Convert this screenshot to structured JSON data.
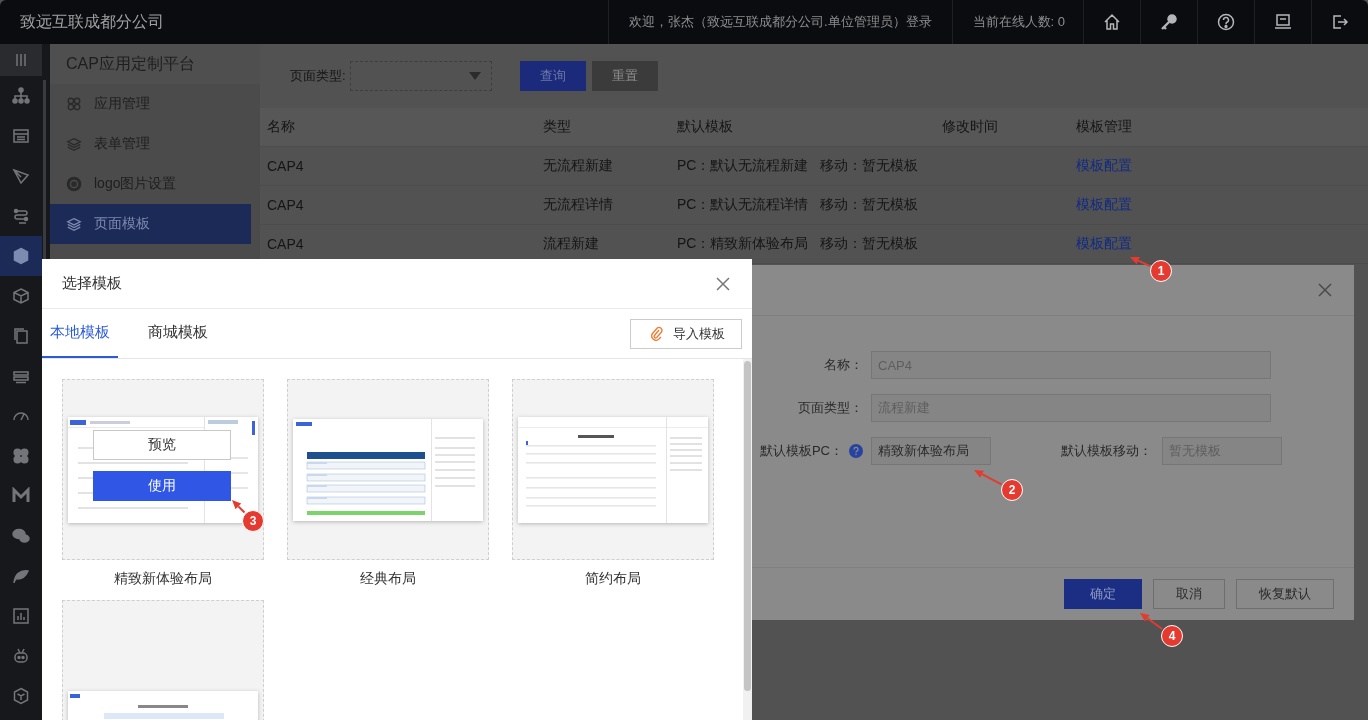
{
  "header": {
    "title": "致远互联成都分公司",
    "welcome": "欢迎，张杰（致远互联成都分公司.单位管理员）登录",
    "online": "当前在线人数: 0",
    "icons": [
      {
        "kind": "home"
      },
      {
        "kind": "key"
      },
      {
        "kind": "help"
      },
      {
        "kind": "monitor"
      },
      {
        "kind": "logout"
      }
    ]
  },
  "rail": [
    {
      "kind": "menu",
      "selected": false
    },
    {
      "kind": "tree",
      "selected": false
    },
    {
      "kind": "form",
      "selected": false
    },
    {
      "kind": "pen",
      "selected": false
    },
    {
      "kind": "flow",
      "selected": false
    },
    {
      "kind": "hexagon",
      "selected": true
    },
    {
      "kind": "cube",
      "selected": false
    },
    {
      "kind": "copy",
      "selected": false
    },
    {
      "kind": "stack",
      "selected": false
    },
    {
      "kind": "gauge",
      "selected": false
    },
    {
      "kind": "clover",
      "selected": false
    },
    {
      "kind": "zigzag",
      "selected": false
    },
    {
      "kind": "chat",
      "selected": false
    },
    {
      "kind": "leaf",
      "selected": false
    },
    {
      "kind": "chart",
      "selected": false
    },
    {
      "kind": "robot",
      "selected": false
    },
    {
      "kind": "cubes",
      "selected": false
    }
  ],
  "sidebar": {
    "title": "CAP应用定制平台",
    "items": [
      {
        "kind": "apps",
        "label": "应用管理",
        "selected": false
      },
      {
        "kind": "layers",
        "label": "表单管理",
        "selected": false
      },
      {
        "kind": "logo",
        "label": "logo图片设置",
        "selected": false
      },
      {
        "kind": "layers",
        "label": "页面模板",
        "selected": true
      }
    ]
  },
  "filter": {
    "label": "页面类型:",
    "buttons": [
      {
        "label": "查询",
        "kind": "primary"
      },
      {
        "label": "重置",
        "kind": "disabled"
      }
    ]
  },
  "table": {
    "columns": [
      "名称",
      "类型",
      "默认模板",
      "修改时间",
      "模板管理"
    ],
    "rows": [
      {
        "name": "CAP4",
        "type": "无流程新建",
        "default_template": "PC：默认无流程新建   移动：暂无模板",
        "action": "模板配置"
      },
      {
        "name": "CAP4",
        "type": "无流程详情",
        "default_template": "PC：默认无流程详情   移动：暂无模板",
        "action": "模板配置"
      },
      {
        "name": "CAP4",
        "type": "流程新建",
        "default_template": "PC：精致新体验布局   移动：暂无模板",
        "action": "模板配置"
      }
    ]
  },
  "config_dialog": {
    "fields": [
      {
        "label": "名称：",
        "value": "CAP4",
        "kind": "wide",
        "disabled": true
      },
      {
        "label": "页面类型：",
        "value": "流程新建",
        "kind": "wide",
        "disabled": true
      },
      {
        "label": "默认模板PC：",
        "value": "精致新体验布局",
        "kind": "narrow",
        "disabled": false,
        "help": true
      },
      {
        "label": "默认模板移动：",
        "value": "暂无模板",
        "kind": "narrow",
        "disabled": true
      }
    ],
    "buttons": [
      {
        "label": "确定",
        "kind": "primary"
      },
      {
        "label": "取消",
        "kind": "default"
      },
      {
        "label": "恢复默认",
        "kind": "default"
      }
    ]
  },
  "template_dialog": {
    "title": "选择模板",
    "tabs": [
      {
        "label": "本地模板",
        "selected": true
      },
      {
        "label": "商城模板",
        "selected": false
      }
    ],
    "import_button": "导入模板",
    "templates": [
      {
        "kind": "refined",
        "name": "精致新体验布局",
        "actions": [
          "预览",
          "使用"
        ]
      },
      {
        "kind": "classic",
        "name": "经典布局"
      },
      {
        "kind": "simple",
        "name": "简约布局"
      },
      {
        "kind": "report"
      }
    ]
  },
  "annotations": [
    {
      "label": "1"
    },
    {
      "label": "2"
    },
    {
      "label": "3"
    },
    {
      "label": "4"
    }
  ]
}
